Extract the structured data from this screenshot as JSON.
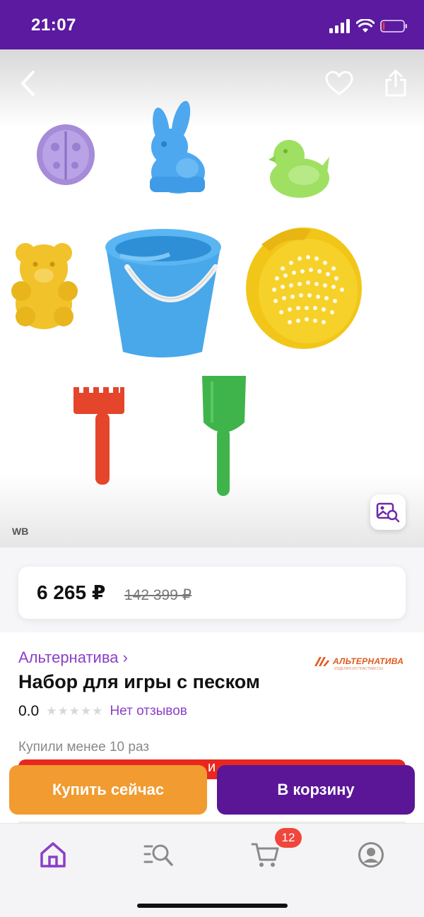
{
  "status_bar": {
    "time": "21:07",
    "icons": [
      "signal-icon",
      "wifi-icon",
      "battery-icon"
    ],
    "battery_level": 0.1,
    "colors": {
      "background": "#5b1aa0",
      "battery": "#e8354a"
    }
  },
  "gallery": {
    "watermark": "WB",
    "icons": [
      "back-icon",
      "heart-icon",
      "share-icon",
      "visual-search-icon"
    ],
    "products": [
      "ladybug-mold",
      "bunny-mold",
      "duck-mold",
      "bear-mold",
      "bucket",
      "sieve",
      "rake",
      "shovel"
    ]
  },
  "price": {
    "current": "6 265 ₽",
    "old": "142 399 ₽"
  },
  "product": {
    "brand": "Альтернатива ›",
    "brand_logo": "АЛЬТЕРНАТИВА",
    "brand_logo_tagline": "ИЗДЕЛИЯ ИЗ ПЛАСТМАССЫ",
    "title": "Набор для игры с песком",
    "rating": "0.0",
    "rating_stars": 0,
    "reviews": "Нет отзывов",
    "bought": "Купили менее 10 раз",
    "promo_fragment": "и"
  },
  "actions": {
    "buy_now": "Купить сейчас",
    "add_to_cart": "В корзину",
    "colors": {
      "buy_now": "#f19b30",
      "add_to_cart": "#5a1696"
    }
  },
  "tab_bar": {
    "tabs": [
      "home-icon",
      "catalog-search-icon",
      "cart-icon",
      "profile-icon"
    ],
    "active": "home-icon",
    "cart_count": "12",
    "colors": {
      "active": "#8b3fc9",
      "inactive": "#8a8a8a",
      "badge": "#f0463c"
    }
  }
}
